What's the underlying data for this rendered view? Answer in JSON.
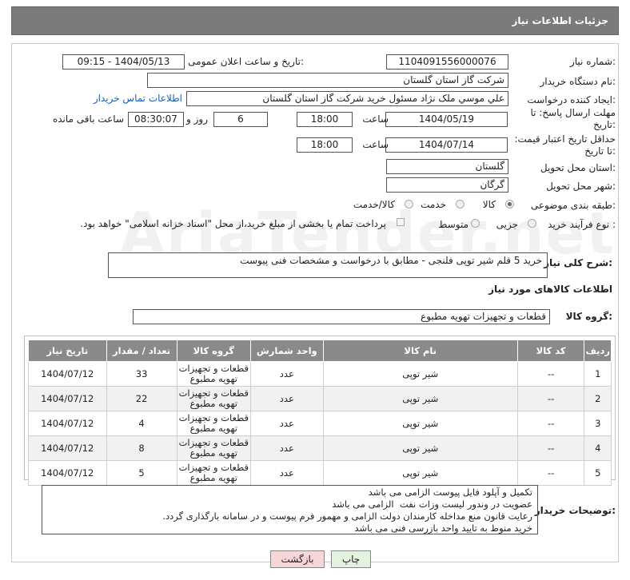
{
  "header": {
    "title": "جزئیات اطلاعات نیاز"
  },
  "fields": {
    "need_number_label": "شماره نیاز:",
    "need_number": "1104091556000076",
    "announce_label": "تاریخ و ساعت اعلان عمومی:",
    "announce_value": "1404/05/13 - 09:15",
    "buyer_label": "نام دستگاه خریدار:",
    "buyer_value": "شرکت گاز استان گلستان",
    "creator_label": "ایجاد کننده درخواست:",
    "creator_value": "علي موسي ملک نژاد مسئول خرید شرکت گاز استان گلستان",
    "contact_link": "اطلاعات تماس خریدار",
    "deadline_label": "مهلت ارسال پاسخ: تا تاریخ:",
    "deadline_date": "1404/05/19",
    "time_label": "ساعت",
    "deadline_time": "18:00",
    "days_value": "6",
    "days_label": "روز و",
    "remaining_time": "08:30:07",
    "remaining_label": "ساعت باقی مانده",
    "validity_label": "حداقل تاریخ اعتبار قیمت: تا تاریخ:",
    "validity_date": "1404/07/14",
    "validity_time": "18:00",
    "province_label": "استان محل تحویل:",
    "province_value": "گلستان",
    "city_label": "شهر محل تحویل:",
    "city_value": "گرگان",
    "category_label": "طبقه بندی موضوعی:",
    "category_options": [
      "کالا",
      "خدمت",
      "کالا/خدمت"
    ],
    "category_selected": "کالا",
    "process_label": "نوع فرآیند خرید :",
    "process_options": [
      "جزیی",
      "متوسط"
    ],
    "payment_text": "پرداخت تمام یا بخشی از مبلغ خرید،از محل \"اسناد خزانه اسلامی\" خواهد بود."
  },
  "description": {
    "label": "شرح کلی نیاز:",
    "value": "خرید 5 قلم شیر توپی فلنجی  - مطابق با درخواست و مشخصات فنی پیوست"
  },
  "goods_section": {
    "title": "اطلاعات کالاهای مورد نیاز",
    "group_label": "گروه کالا:",
    "group_value": "قطعات و تجهیزات تهویه مطبوع"
  },
  "table": {
    "headers": [
      "ردیف",
      "کد کالا",
      "نام کالا",
      "واحد شمارش",
      "گروه کالا",
      "تعداد / مقدار",
      "تاریخ نیاز"
    ],
    "rows": [
      {
        "row": "1",
        "code": "--",
        "name": "شیر توپی",
        "unit": "عدد",
        "group": "قطعات و تجهیزات تهویه مطبوع",
        "qty": "33",
        "date": "1404/07/12"
      },
      {
        "row": "2",
        "code": "--",
        "name": "شیر توپی",
        "unit": "عدد",
        "group": "قطعات و تجهیزات تهویه مطبوع",
        "qty": "22",
        "date": "1404/07/12"
      },
      {
        "row": "3",
        "code": "--",
        "name": "شیر توپی",
        "unit": "عدد",
        "group": "قطعات و تجهیزات تهویه مطبوع",
        "qty": "4",
        "date": "1404/07/12"
      },
      {
        "row": "4",
        "code": "--",
        "name": "شیر توپی",
        "unit": "عدد",
        "group": "قطعات و تجهیزات تهویه مطبوع",
        "qty": "8",
        "date": "1404/07/12"
      },
      {
        "row": "5",
        "code": "--",
        "name": "شیر توپی",
        "unit": "عدد",
        "group": "قطعات و تجهیزات تهویه مطبوع",
        "qty": "5",
        "date": "1404/07/12"
      }
    ]
  },
  "buyer_notes": {
    "label": "توضیحات خریدار:",
    "value": "تکمیل و آپلود فایل پیوست الزامی می باشد\nعضویت در وندور لیست وزات نفت  الزامی می باشد\nرعایت قانون منع مداخله کارمندان دولت الزامی و مهمور فرم پیوست و در سامانه بارگذاری گردد.\nخرید منوط به تایید واحد بازرسی فنی می باشد"
  },
  "buttons": {
    "print": "چاپ",
    "back": "بازگشت"
  },
  "colors": {
    "header_bg": "#7b7b7b",
    "table_header_bg": "#8a8a8a",
    "link": "#1a5fb4",
    "back_button_bg": "#f6d6d6",
    "print_button_bg": "#e4f3e0"
  }
}
